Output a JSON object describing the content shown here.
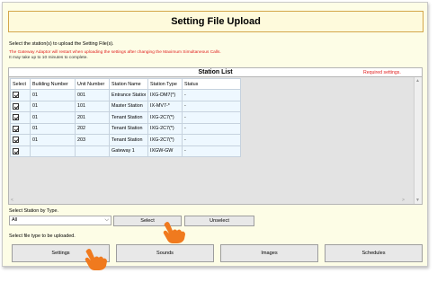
{
  "title": "Setting File Upload",
  "instruction": "Select the station(s) to upload the Setting File(s).",
  "warning_line1": "The Gateway Adaptor will restart when uploading the settings after changing the Maximum Simultaneous Calls.",
  "warning_line2": "It may take up to 10 minutes to complete.",
  "station_list": {
    "title": "Station List",
    "required_note": "Required settings.",
    "columns": [
      "Select",
      "Building Number",
      "Unit Number",
      "Station Name",
      "Station Type",
      "Status"
    ],
    "rows": [
      {
        "building": "01",
        "unit": "001",
        "name": "Entrance Station",
        "type": "IXG-DM7(*)",
        "status": "-"
      },
      {
        "building": "01",
        "unit": "101",
        "name": "Master Station",
        "type": "IX-MV7-*",
        "status": "-"
      },
      {
        "building": "01",
        "unit": "201",
        "name": "Tenant Station",
        "type": "IXG-2C7(*)",
        "status": "-"
      },
      {
        "building": "01",
        "unit": "202",
        "name": "Tenant Station",
        "type": "IXG-2C7(*)",
        "status": "-"
      },
      {
        "building": "01",
        "unit": "203",
        "name": "Tenant Station",
        "type": "IXG-2C7(*)",
        "status": "-"
      },
      {
        "building": "",
        "unit": "",
        "name": "Gateway 1",
        "type": "IXGW-GW",
        "status": "-"
      }
    ]
  },
  "select_by_type": {
    "label": "Select Station by Type.",
    "selected": "All",
    "select_label": "Select",
    "unselect_label": "Unselect"
  },
  "file_type": {
    "label": "Select file type to be uploaded.",
    "buttons": [
      "Settings",
      "Sounds",
      "Images",
      "Schedules"
    ]
  },
  "colors": {
    "title_border": "#d4a64a",
    "warning": "#e02020",
    "row_bg": "#eef8ff",
    "pointer": "#f07a1e"
  }
}
